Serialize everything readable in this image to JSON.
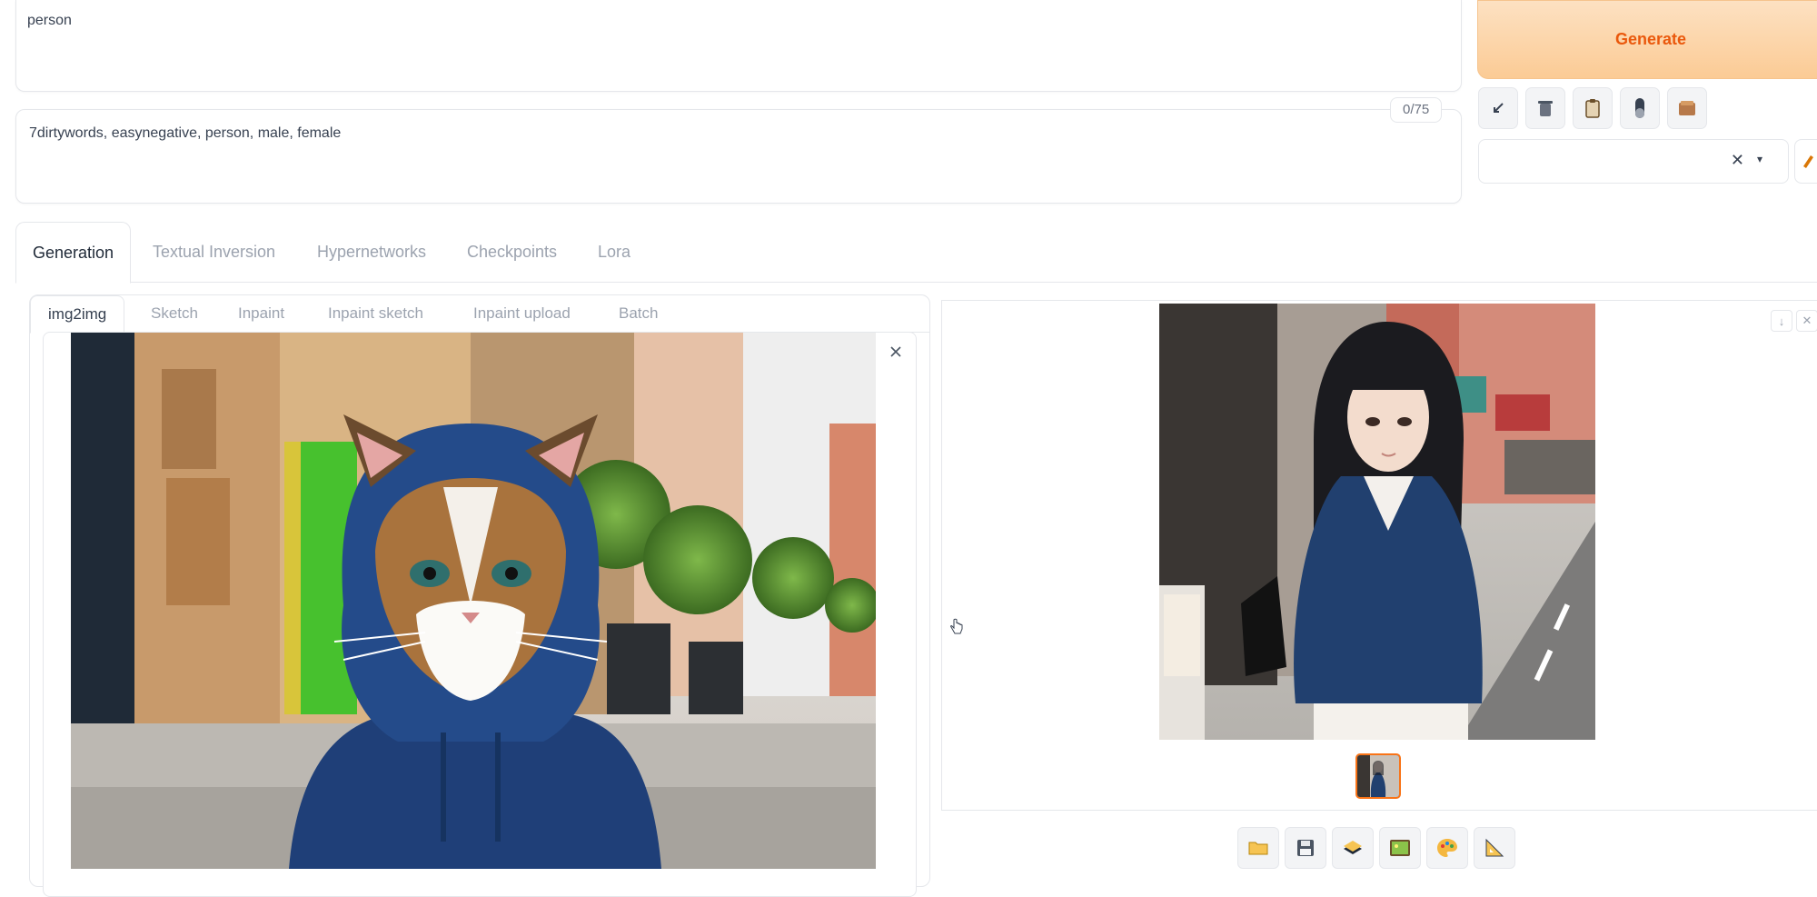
{
  "prompt": {
    "positive_text": "person",
    "negative_text": "7dirtywords, easynegative, person, male, female",
    "negative_counter": "0/75"
  },
  "generate": {
    "label": "Generate"
  },
  "toolbar": {
    "icons": [
      "arrow-icon",
      "trash-icon",
      "clipboard-icon",
      "pill-icon",
      "box-icon"
    ]
  },
  "style_select": {
    "clear": "✕",
    "caret": "▾"
  },
  "tabs": [
    {
      "label": "Generation",
      "active": true
    },
    {
      "label": "Textual Inversion"
    },
    {
      "label": "Hypernetworks"
    },
    {
      "label": "Checkpoints"
    },
    {
      "label": "Lora"
    }
  ],
  "subtabs": [
    {
      "label": "img2img",
      "active": true
    },
    {
      "label": "Sketch"
    },
    {
      "label": "Inpaint"
    },
    {
      "label": "Inpaint sketch"
    },
    {
      "label": "Inpaint upload"
    },
    {
      "label": "Batch"
    }
  ],
  "output_actions": [
    "folder-icon",
    "save-icon",
    "zip-icon",
    "image-icon",
    "palette-icon",
    "ruler-icon"
  ],
  "colors": {
    "accent": "#ea580c",
    "generate_bg": "#fbcb95"
  }
}
